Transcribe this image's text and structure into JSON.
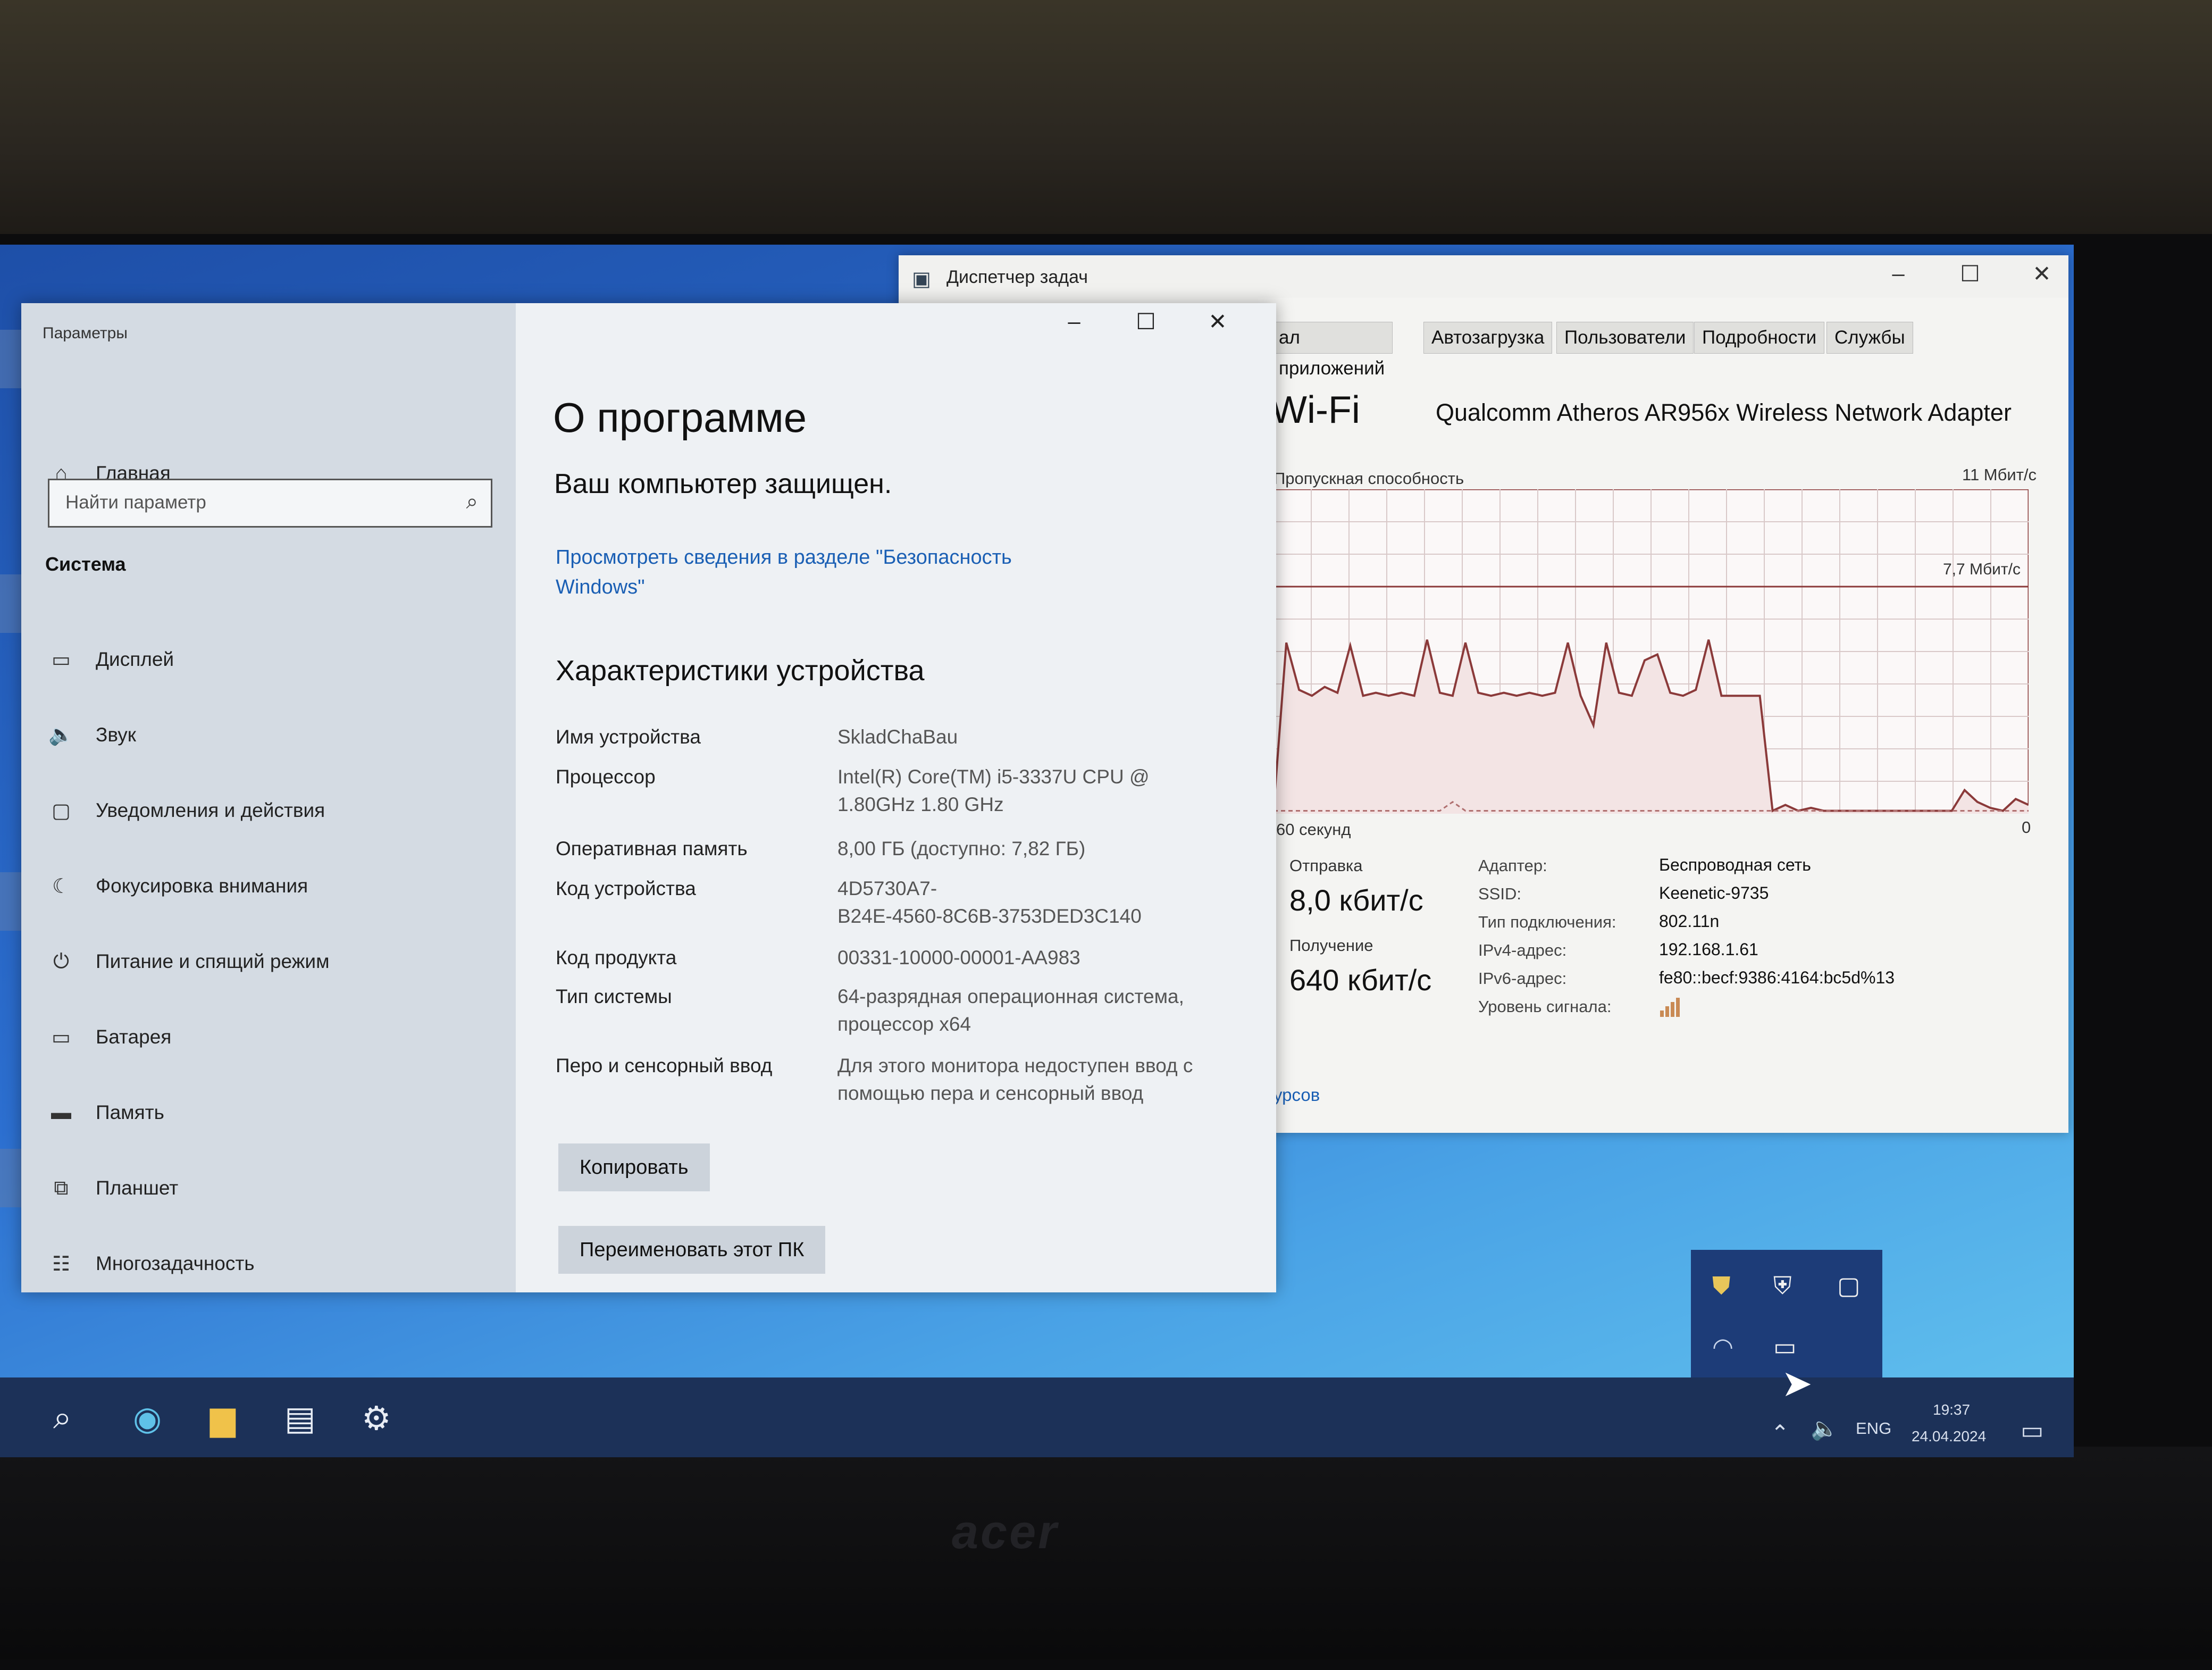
{
  "settings": {
    "window_title": "Параметры",
    "nav_home": "Главная",
    "search_placeholder": "Найти параметр",
    "section": "Система",
    "items": [
      {
        "label": "Дисплей",
        "icon": "display-icon"
      },
      {
        "label": "Звук",
        "icon": "speaker-icon"
      },
      {
        "label": "Уведомления и действия",
        "icon": "notification-icon"
      },
      {
        "label": "Фокусировка внимания",
        "icon": "moon-icon"
      },
      {
        "label": "Питание и спящий режим",
        "icon": "power-icon"
      },
      {
        "label": "Батарея",
        "icon": "battery-icon"
      },
      {
        "label": "Память",
        "icon": "storage-icon"
      },
      {
        "label": "Планшет",
        "icon": "tablet-icon"
      },
      {
        "label": "Многозадачность",
        "icon": "multitasking-icon"
      }
    ],
    "page_title": "О программе",
    "protected": "Ваш компьютер защищен.",
    "security_link_line1": "Просмотреть сведения в разделе \"Безопасность",
    "security_link_line2": "Windows\"",
    "specs_heading": "Характеристики устройства",
    "specs": [
      {
        "label": "Имя устройства",
        "value": "SkladChaBau"
      },
      {
        "label": "Процессор",
        "value": "Intel(R) Core(TM) i5-3337U CPU @",
        "value2": "1.80GHz   1.80 GHz"
      },
      {
        "label": "Оперативная память",
        "value": "8,00 ГБ (доступно: 7,82 ГБ)"
      },
      {
        "label": "Код устройства",
        "value": "4D5730A7-",
        "value2": "B24E-4560-8C6B-3753DED3C140"
      },
      {
        "label": "Код продукта",
        "value": "00331-10000-00001-AA983"
      },
      {
        "label": "Тип системы",
        "value": "64-разрядная операционная система,",
        "value2": "процессор x64"
      },
      {
        "label": "Перо и сенсорный ввод",
        "value": "Для этого монитора недоступен ввод с",
        "value2": "помощью пера и сенсорный ввод"
      }
    ],
    "copy_button": "Копировать",
    "rename_button": "Переименовать этот ПК"
  },
  "task_manager": {
    "title": "Диспетчер задач",
    "tabs": [
      "ал приложений",
      "Автозагрузка",
      "Пользователи",
      "Подробности",
      "Службы"
    ],
    "wifi_title": "Wi-Fi",
    "adapter_name": "Qualcomm Atheros AR956x Wireless Network Adapter",
    "throughput_label": "Пропускная способность",
    "max_label": "11 Мбит/с",
    "mid_label": "7,7 Мбит/с",
    "time_label": "60 секунд",
    "zero_label": "0",
    "send_label": "Отправка",
    "send_value": "8,0 кбит/с",
    "recv_label": "Получение",
    "recv_value": "640 кбит/с",
    "details": [
      {
        "k": "Адаптер:",
        "v": "Беспроводная сеть"
      },
      {
        "k": "SSID:",
        "v": "Keenetic-9735"
      },
      {
        "k": "Тип подключения:",
        "v": "802.11n"
      },
      {
        "k": "IPv4-адрес:",
        "v": "192.168.1.61"
      },
      {
        "k": "IPv6-адрес:",
        "v": "fe80::becf:9386:4164:bc5d%13"
      },
      {
        "k": "Уровень сигнала:",
        "v": ""
      }
    ],
    "resources_link": "урсов",
    "graph_max": 11,
    "graph_receive": [
      0.1,
      5.8,
      4.2,
      4.0,
      4.3,
      4.1,
      5.7,
      4.0,
      4.1,
      4.0,
      4.1,
      4.0,
      5.9,
      4.1,
      4.0,
      5.8,
      4.1,
      4.0,
      4.1,
      4.0,
      4.1,
      4.0,
      4.1,
      5.8,
      4.0,
      3.0,
      5.8,
      4.1,
      4.0,
      5.2,
      5.4,
      4.1,
      4.0,
      4.2,
      5.9,
      4.0,
      4.0,
      4.0,
      4.0,
      0.1,
      0.3,
      0.1,
      0.2,
      0.1,
      0.1,
      0.1,
      0.1,
      0.1,
      0.1,
      0.1,
      0.1,
      0.1,
      0.1,
      0.1,
      0.8,
      0.4,
      0.2,
      0.1,
      0.5,
      0.3
    ],
    "graph_send": [
      0.1,
      0.1,
      0.1,
      0.1,
      0.1,
      0.1,
      0.1,
      0.1,
      0.1,
      0.1,
      0.1,
      0.1,
      0.1,
      0.1,
      0.4,
      0.1,
      0.1,
      0.1,
      0.1,
      0.1,
      0.1,
      0.1,
      0.1,
      0.1,
      0.1,
      0.1,
      0.1,
      0.1,
      0.1,
      0.1,
      0.1,
      0.1,
      0.1,
      0.1,
      0.1,
      0.1,
      0.1,
      0.1,
      0.1,
      0.1,
      0.1,
      0.1,
      0.1,
      0.1,
      0.1,
      0.1,
      0.1,
      0.1,
      0.1,
      0.1,
      0.1,
      0.1,
      0.1,
      0.1,
      0.1,
      0.1,
      0.1,
      0.1,
      0.1,
      0.1
    ],
    "graph_colors": {
      "line": "#8b3a3a",
      "fill": "#f3e4e4",
      "grid": "#d9c9c9"
    }
  },
  "taskbar": {
    "lang": "ENG",
    "time": "19:37",
    "date": "24.04.2024"
  },
  "branding": "acer"
}
